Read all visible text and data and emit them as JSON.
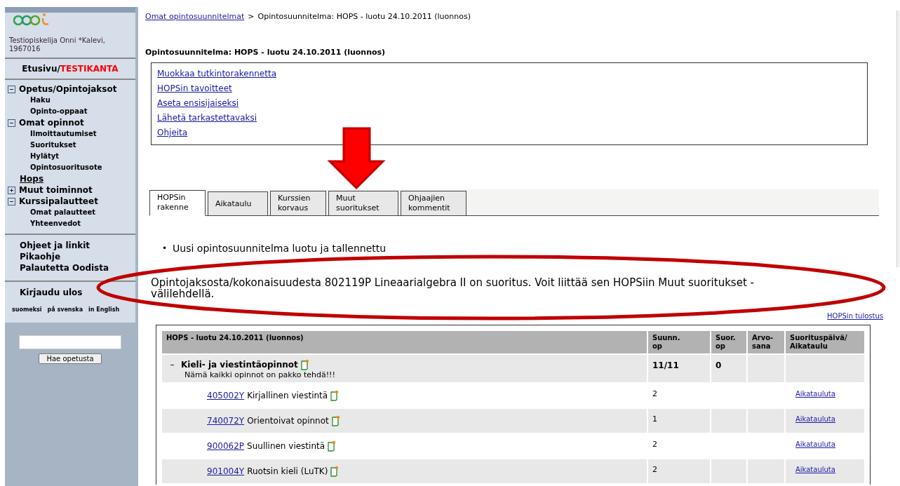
{
  "sidebar": {
    "user": "Testiopiskelija Onni *Kalevi, 1967016",
    "home": {
      "label": "Etusivu/",
      "highlight": "TESTIKANTA"
    },
    "menu": [
      {
        "kind": "group",
        "label": "Opetus/Opintojaksot",
        "expanded": true,
        "children": [
          {
            "label": "Haku"
          },
          {
            "label": "Opinto-oppaat"
          }
        ]
      },
      {
        "kind": "group",
        "label": "Omat opinnot",
        "expanded": true,
        "children": [
          {
            "label": "Ilmoittautumiset"
          },
          {
            "label": "Suoritukset"
          },
          {
            "label": "Hylätyt"
          },
          {
            "label": "Opintosuoritusote"
          }
        ]
      },
      {
        "kind": "current",
        "label": "Hops"
      },
      {
        "kind": "group",
        "label": "Muut toiminnot",
        "expanded": false
      },
      {
        "kind": "group",
        "label": "Kurssipalautteet",
        "expanded": true,
        "children": [
          {
            "label": "Omat palautteet"
          },
          {
            "label": "Yhteenvedot"
          }
        ]
      }
    ],
    "links": [
      "Ohjeet ja linkit",
      "Pikaohje",
      "Palautetta Oodista"
    ],
    "logout": "Kirjaudu ulos",
    "languages": [
      "suomeksi",
      "på svenska",
      "in English"
    ],
    "search_button": "Hae opetusta"
  },
  "breadcrumb": {
    "link": "Omat opintosuunnitelmat",
    "separator": ">",
    "current": "Opintosuunnitelma: HOPS - luotu 24.10.2011 (luonnos)"
  },
  "heading": "Opintosuunnitelma: HOPS - luotu 24.10.2011 (luonnos)",
  "actions": [
    "Muokkaa tutkintorakennetta",
    "HOPSin tavoitteet",
    "Aseta ensisijaiseksi",
    "Lähetä tarkastettavaksi",
    "Ohjeita"
  ],
  "tabs": [
    {
      "label": "HOPSin rakenne",
      "selected": true
    },
    {
      "label": "Aikataulu",
      "selected": false
    },
    {
      "label": "Kurssien korvaus",
      "selected": false
    },
    {
      "label": "Muut suoritukset",
      "selected": false
    },
    {
      "label": "Ohjaajien kommentit",
      "selected": false
    }
  ],
  "messages": [
    {
      "marker": "•",
      "text": "Uusi opintosuunnitelma luotu ja tallennettu"
    }
  ],
  "info": "Opintojaksosta/kokonaisuudesta 802119P Lineaarialgebra II on suoritus. Voit liittää sen HOPSiin Muut suoritukset -välilehdellä.",
  "print_link": "HOPSin tulostus",
  "table": {
    "columns": [
      "HOPS - luotu 24.10.2011 (luonnos)",
      "Suunn. op",
      "Suor. op",
      "Arvo-sana",
      "Suorituspäivä/ Aikataulu"
    ],
    "groups": [
      {
        "name": "Kieli- ja viestintäopinnot",
        "note": "Nämä kaikki opinnot on pakko tehdä!!!",
        "expanded": true,
        "planned": "11/11",
        "done": "0",
        "rows": [
          {
            "code": "405002Y",
            "name": "Kirjallinen viestintä",
            "planned": "2",
            "action": "Aikatauluta"
          },
          {
            "code": "740072Y",
            "name": "Orientoivat opinnot",
            "planned": "1",
            "action": "Aikatauluta"
          },
          {
            "code": "900062P",
            "name": "Suullinen viestintä",
            "planned": "2",
            "action": "Aikatauluta"
          },
          {
            "code": "901004Y",
            "name": "Ruotsin kieli (LuTK)",
            "planned": "2",
            "action": "Aikatauluta"
          }
        ]
      }
    ]
  }
}
